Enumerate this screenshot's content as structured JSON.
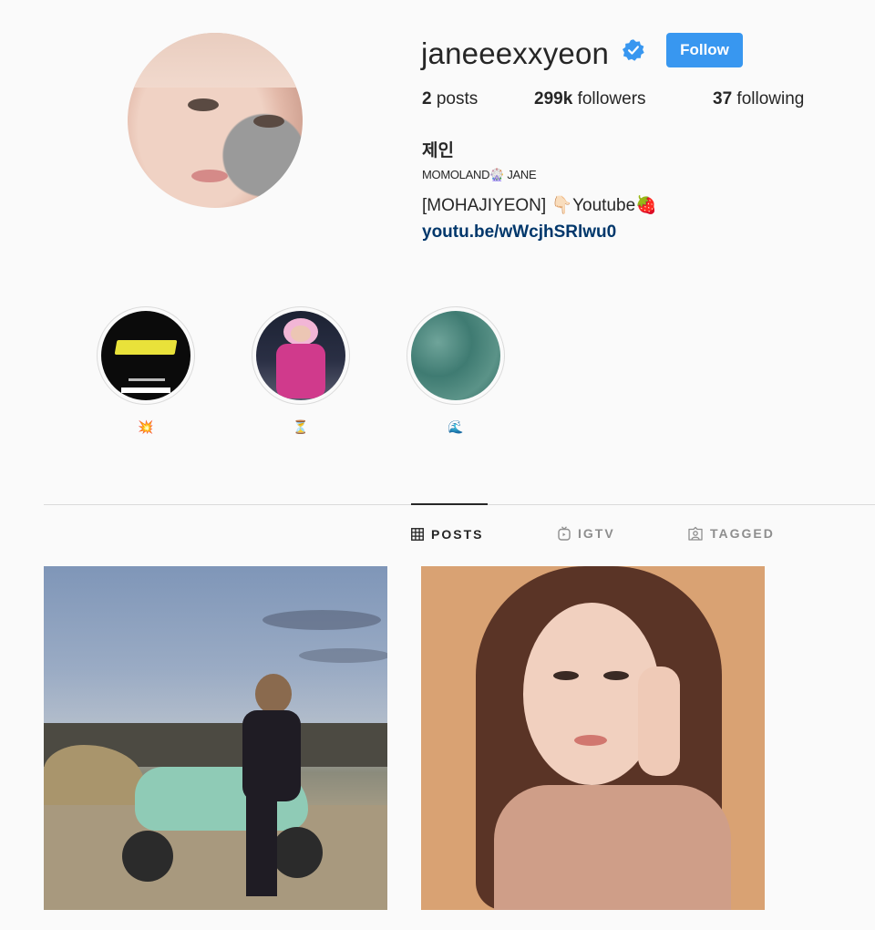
{
  "profile": {
    "username": "janeeexxyeon",
    "verified": true,
    "follow_label": "Follow",
    "stats": {
      "posts_count": "2",
      "posts_label": "posts",
      "followers_count": "299k",
      "followers_label": "followers",
      "following_count": "37",
      "following_label": "following"
    },
    "full_name": "제인",
    "bio_line1": "MOMOLAND🎡 JANE",
    "bio_line2": "[MOHAJIYEON] 👇🏻Youtube🍓",
    "bio_link": "youtu.be/wWcjhSRlwu0"
  },
  "highlights": [
    {
      "label": "💥",
      "cover": "dark-title-card"
    },
    {
      "label": "⏳",
      "cover": "pink-winter-outfit"
    },
    {
      "label": "🌊",
      "cover": "sea-water"
    }
  ],
  "tabs": [
    {
      "label": "POSTS",
      "icon": "grid-icon",
      "active": true
    },
    {
      "label": "IGTV",
      "icon": "igtv-icon",
      "active": false
    },
    {
      "label": "TAGGED",
      "icon": "tagged-icon",
      "active": false
    }
  ],
  "posts": [
    {
      "subject": "woman-on-mint-scooter"
    },
    {
      "subject": "woman-portrait-peach-background"
    }
  ],
  "colors": {
    "accent": "#3897f0",
    "verified_badge": "#3897f0",
    "link": "#00376b",
    "text": "#262626",
    "muted": "#8e8e8e",
    "background": "#fafafa"
  }
}
